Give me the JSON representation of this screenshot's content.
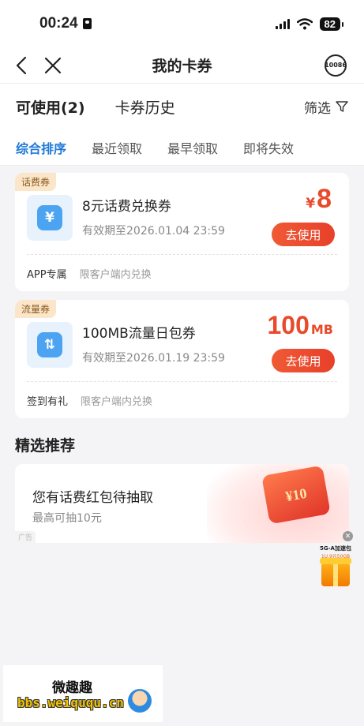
{
  "status_bar": {
    "time": "00:24",
    "battery": "82"
  },
  "nav": {
    "title": "我的卡券",
    "service_label": "10086"
  },
  "tabs": [
    {
      "label": "可使用(2)"
    },
    {
      "label": "卡券历史"
    }
  ],
  "filter_label": "筛选",
  "sort_options": [
    {
      "label": "综合排序"
    },
    {
      "label": "最近领取"
    },
    {
      "label": "最早领取"
    },
    {
      "label": "即将失效"
    }
  ],
  "coupons": [
    {
      "tag": "话费券",
      "icon_glyph": "¥",
      "name": "8元话费兑换券",
      "expiry": "有效期至2026.01.04 23:59",
      "price_prefix": "¥",
      "price_value": "8",
      "price_unit": "",
      "button": "去使用",
      "foot_label": "APP专属",
      "foot_note": "限客户端内兑换"
    },
    {
      "tag": "流量券",
      "icon_glyph": "⇅",
      "name": "100MB流量日包券",
      "expiry": "有效期至2026.01.19 23:59",
      "price_prefix": "",
      "price_value": "100",
      "price_unit": "MB",
      "button": "去使用",
      "foot_label": "签到有礼",
      "foot_note": "限客户端内兑换"
    }
  ],
  "recommend": {
    "section_title": "精选推荐",
    "promo_title": "您有话费红包待抽取",
    "promo_sub": "最高可抽10元",
    "promo_art_text": "¥10",
    "ad_label": "广告"
  },
  "float_badge": {
    "line1": "5G-A加速包",
    "line2": "1U.9元50GB"
  },
  "watermark": {
    "title": "微趣趣",
    "url": "bbs.weiququ.cn"
  },
  "colors": {
    "accent_blue": "#1f79d6",
    "price_red": "#e84a2b",
    "tag_bg": "#fbe6c9"
  }
}
